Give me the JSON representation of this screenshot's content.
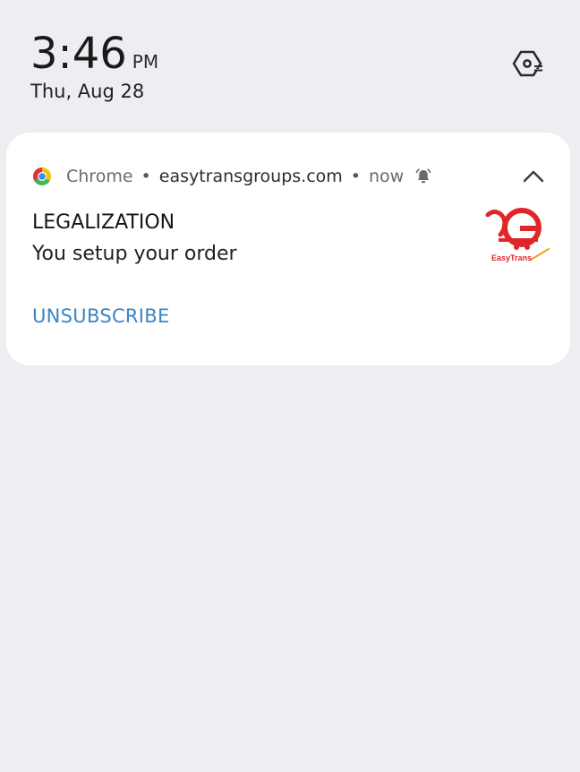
{
  "clock": {
    "time": "3:46",
    "ampm": "PM",
    "date": "Thu, Aug 28"
  },
  "notification": {
    "app_name": "Chrome",
    "separator": "•",
    "site": "easytransgroups.com",
    "when": "now",
    "title": "LEGALIZATION",
    "body": "You setup your order",
    "action_label": "UNSUBSCRIBE",
    "logo_text": "EasyTrans"
  },
  "icons": {
    "settings": "settings-gear-hexagon-icon",
    "app": "chrome-icon",
    "alert": "bell-ringing-icon",
    "expand": "chevron-up-icon"
  },
  "colors": {
    "background": "#eeeef2",
    "card": "#ffffff",
    "action": "#3b84c6",
    "logo_red": "#e0262a"
  }
}
